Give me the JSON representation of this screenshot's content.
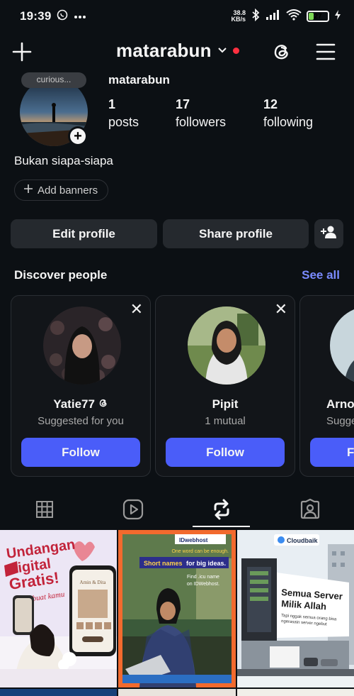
{
  "status_bar": {
    "time": "19:39",
    "net_speed_value": "38.8",
    "net_speed_unit": "KB/s",
    "battery_level": "27",
    "battery_fraction": 0.27
  },
  "header": {
    "username": "matarabun"
  },
  "profile": {
    "note_text": "curious...",
    "display_name": "matarabun",
    "stats": [
      {
        "value": "1",
        "label": "posts"
      },
      {
        "value": "17",
        "label": "followers"
      },
      {
        "value": "12",
        "label": "following"
      }
    ],
    "bio": "Bukan siapa-siapa",
    "add_banners_label": "Add banners"
  },
  "actions": {
    "edit_profile": "Edit profile",
    "share_profile": "Share profile"
  },
  "discover": {
    "title": "Discover people",
    "see_all": "See all",
    "cards": [
      {
        "name": "Yatie77",
        "subtitle": "Suggested for you",
        "button": "Follow"
      },
      {
        "name": "Pipit",
        "subtitle": "1 mutual",
        "button": "Follow"
      },
      {
        "name": "Arno",
        "subtitle": "Sugge",
        "button": "F"
      }
    ]
  },
  "posts": {
    "post1": {
      "line1": "Undangan",
      "line2": "Digital",
      "line3": "Gratis!",
      "line4": "buat kamu",
      "card_title": "Amin & Dita"
    },
    "post2": {
      "brand": "IDwebhost",
      "tagline": "One word can be enough.",
      "headline_a": "Short names",
      "headline_b": "for big ideas.",
      "find_line1": "Find .icu name",
      "find_line2": "on IDWebhost."
    },
    "post3": {
      "brand": "Cloudbaik",
      "billboard_line1": "Semua Server",
      "billboard_line2": "Milik Allah",
      "billboard_sub1": "Tapi nggak semua orang bisa",
      "billboard_sub2": "ngerasain server ngebut"
    }
  },
  "colors": {
    "background": "#0c1014",
    "button": "#25292e",
    "accent": "#4a5df9",
    "link": "#7a8bff",
    "notification_dot": "#ff3040"
  }
}
